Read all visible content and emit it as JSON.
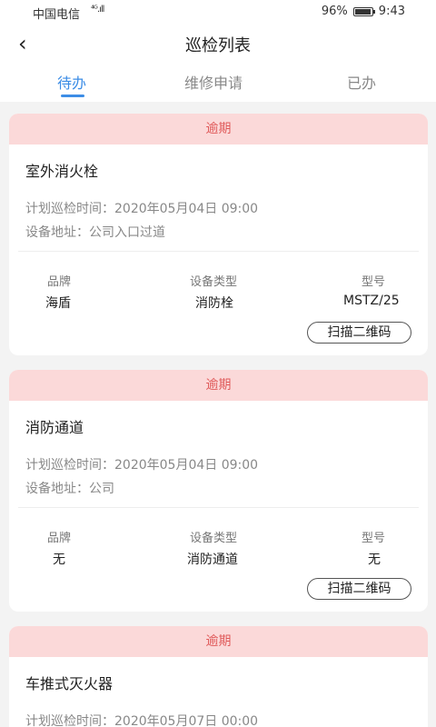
{
  "status": {
    "carrier": "中国电信",
    "signal": "⁴ᴳ.ıll",
    "battery": "96%",
    "time": "9:43"
  },
  "header": {
    "title": "巡检列表"
  },
  "tabs": [
    {
      "label": "待办"
    },
    {
      "label": "维修申请"
    },
    {
      "label": "已办"
    }
  ],
  "cols": {
    "brand": "品牌",
    "type": "设备类型",
    "model": "型号"
  },
  "cards": [
    {
      "badge": "逾期",
      "name": "室外消火栓",
      "time": "计划巡检时间：2020年05月04日 09:00",
      "address": "设备地址：公司入口过道",
      "brand": "海盾",
      "type": "消防栓",
      "model": "MSTZ/25",
      "scan": "扫描二维码"
    },
    {
      "badge": "逾期",
      "name": "消防通道",
      "time": "计划巡检时间：2020年05月04日 09:00",
      "address": "设备地址：公司",
      "brand": "无",
      "type": "消防通道",
      "model": "无",
      "scan": "扫描二维码"
    },
    {
      "badge": "逾期",
      "name": "车推式灭火器",
      "time": "计划巡检时间：2020年05月07日 00:00"
    }
  ]
}
